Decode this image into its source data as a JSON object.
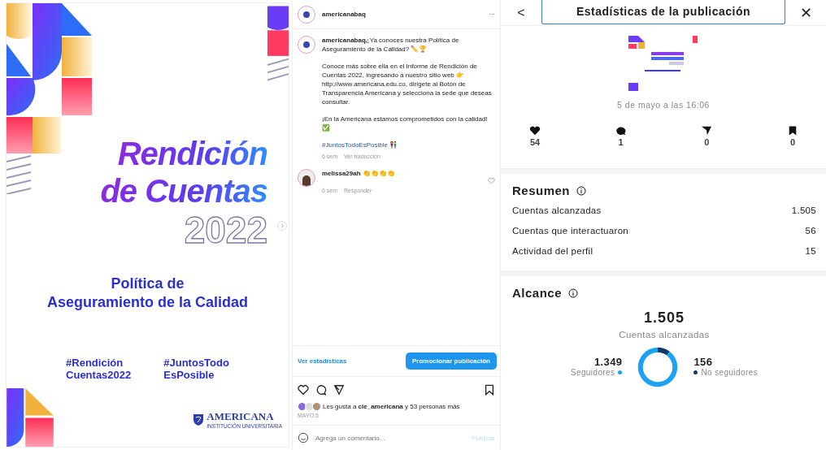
{
  "poster": {
    "title_lines": [
      "Rendición",
      "de Cuentas"
    ],
    "year": "2022",
    "subtitle_lines": [
      "Política de",
      "Aseguramiento de la Calidad"
    ],
    "hashtags": [
      [
        "#Rendición",
        "Cuentas2022"
      ],
      [
        "#JuntosTodo",
        "EsPosible"
      ]
    ],
    "logo": {
      "name": "AMERICANA",
      "tagline": "INSTITUCIÓN UNIVERSITARIA"
    }
  },
  "post": {
    "username": "americanabaq",
    "menu": "···",
    "caption": {
      "username": "americanabaq",
      "paragraphs": [
        "¿Ya conoces nuestra Política de Aseguramiento de la Calidad? ✏️🏆",
        "Conoce más sobre ella en el Informe de Rendición de Cuentas 2022, ingresando a nuestro sitio web 👉 http://www.americana.edu.co, dirígete al Botón de Transparencia Americana y selecciona la sede que deseas consultar.",
        "¡En la Americana estamos comprometidos con la calidad! ✅"
      ],
      "hashtag": "#JuntosTodoEsPosible 👫",
      "age": "6 sem",
      "translate": "Ver traducción"
    },
    "comments": [
      {
        "username": "melissa29ah",
        "text": "👏👏👏👏",
        "age": "6 sem",
        "reply": "Responder",
        "liked": false
      }
    ],
    "stats_link": "Ver estadísticas",
    "promote_button": "Promocionar publicación",
    "likes": "Les gusta a **cie_americana** y 53 personas más",
    "date": "MAYO 5",
    "comment_field": {
      "placeholder": "Agrega un comentario...",
      "submit": "Publicar"
    }
  },
  "insights": {
    "back": "<",
    "title": "Estadísticas de la publicación",
    "close": "✕",
    "date": "5 de mayo a las 16:06",
    "counts": [
      {
        "kind": "likes",
        "value": "54"
      },
      {
        "kind": "comments",
        "value": "1"
      },
      {
        "kind": "shares",
        "value": "0"
      },
      {
        "kind": "saves",
        "value": "0"
      }
    ],
    "summary": {
      "heading": "Resumen",
      "rows": [
        {
          "label": "Cuentas alcanzadas",
          "value": "1.505"
        },
        {
          "label": "Cuentas que interactuaron",
          "value": "56"
        },
        {
          "label": "Actividad del perfil",
          "value": "15"
        }
      ]
    },
    "reach": {
      "heading": "Alcance",
      "total": "1.505",
      "total_label": "Cuentas alcanzadas",
      "legend": [
        {
          "value": "1.349",
          "color": "#1da1f2"
        },
        {
          "value": "156",
          "color": "#0d3b66"
        }
      ],
      "chart_data": {
        "type": "donut",
        "categories": [
          "Seguidores",
          "No seguidores"
        ],
        "values": [
          89.6,
          10.4
        ]
      }
    }
  }
}
